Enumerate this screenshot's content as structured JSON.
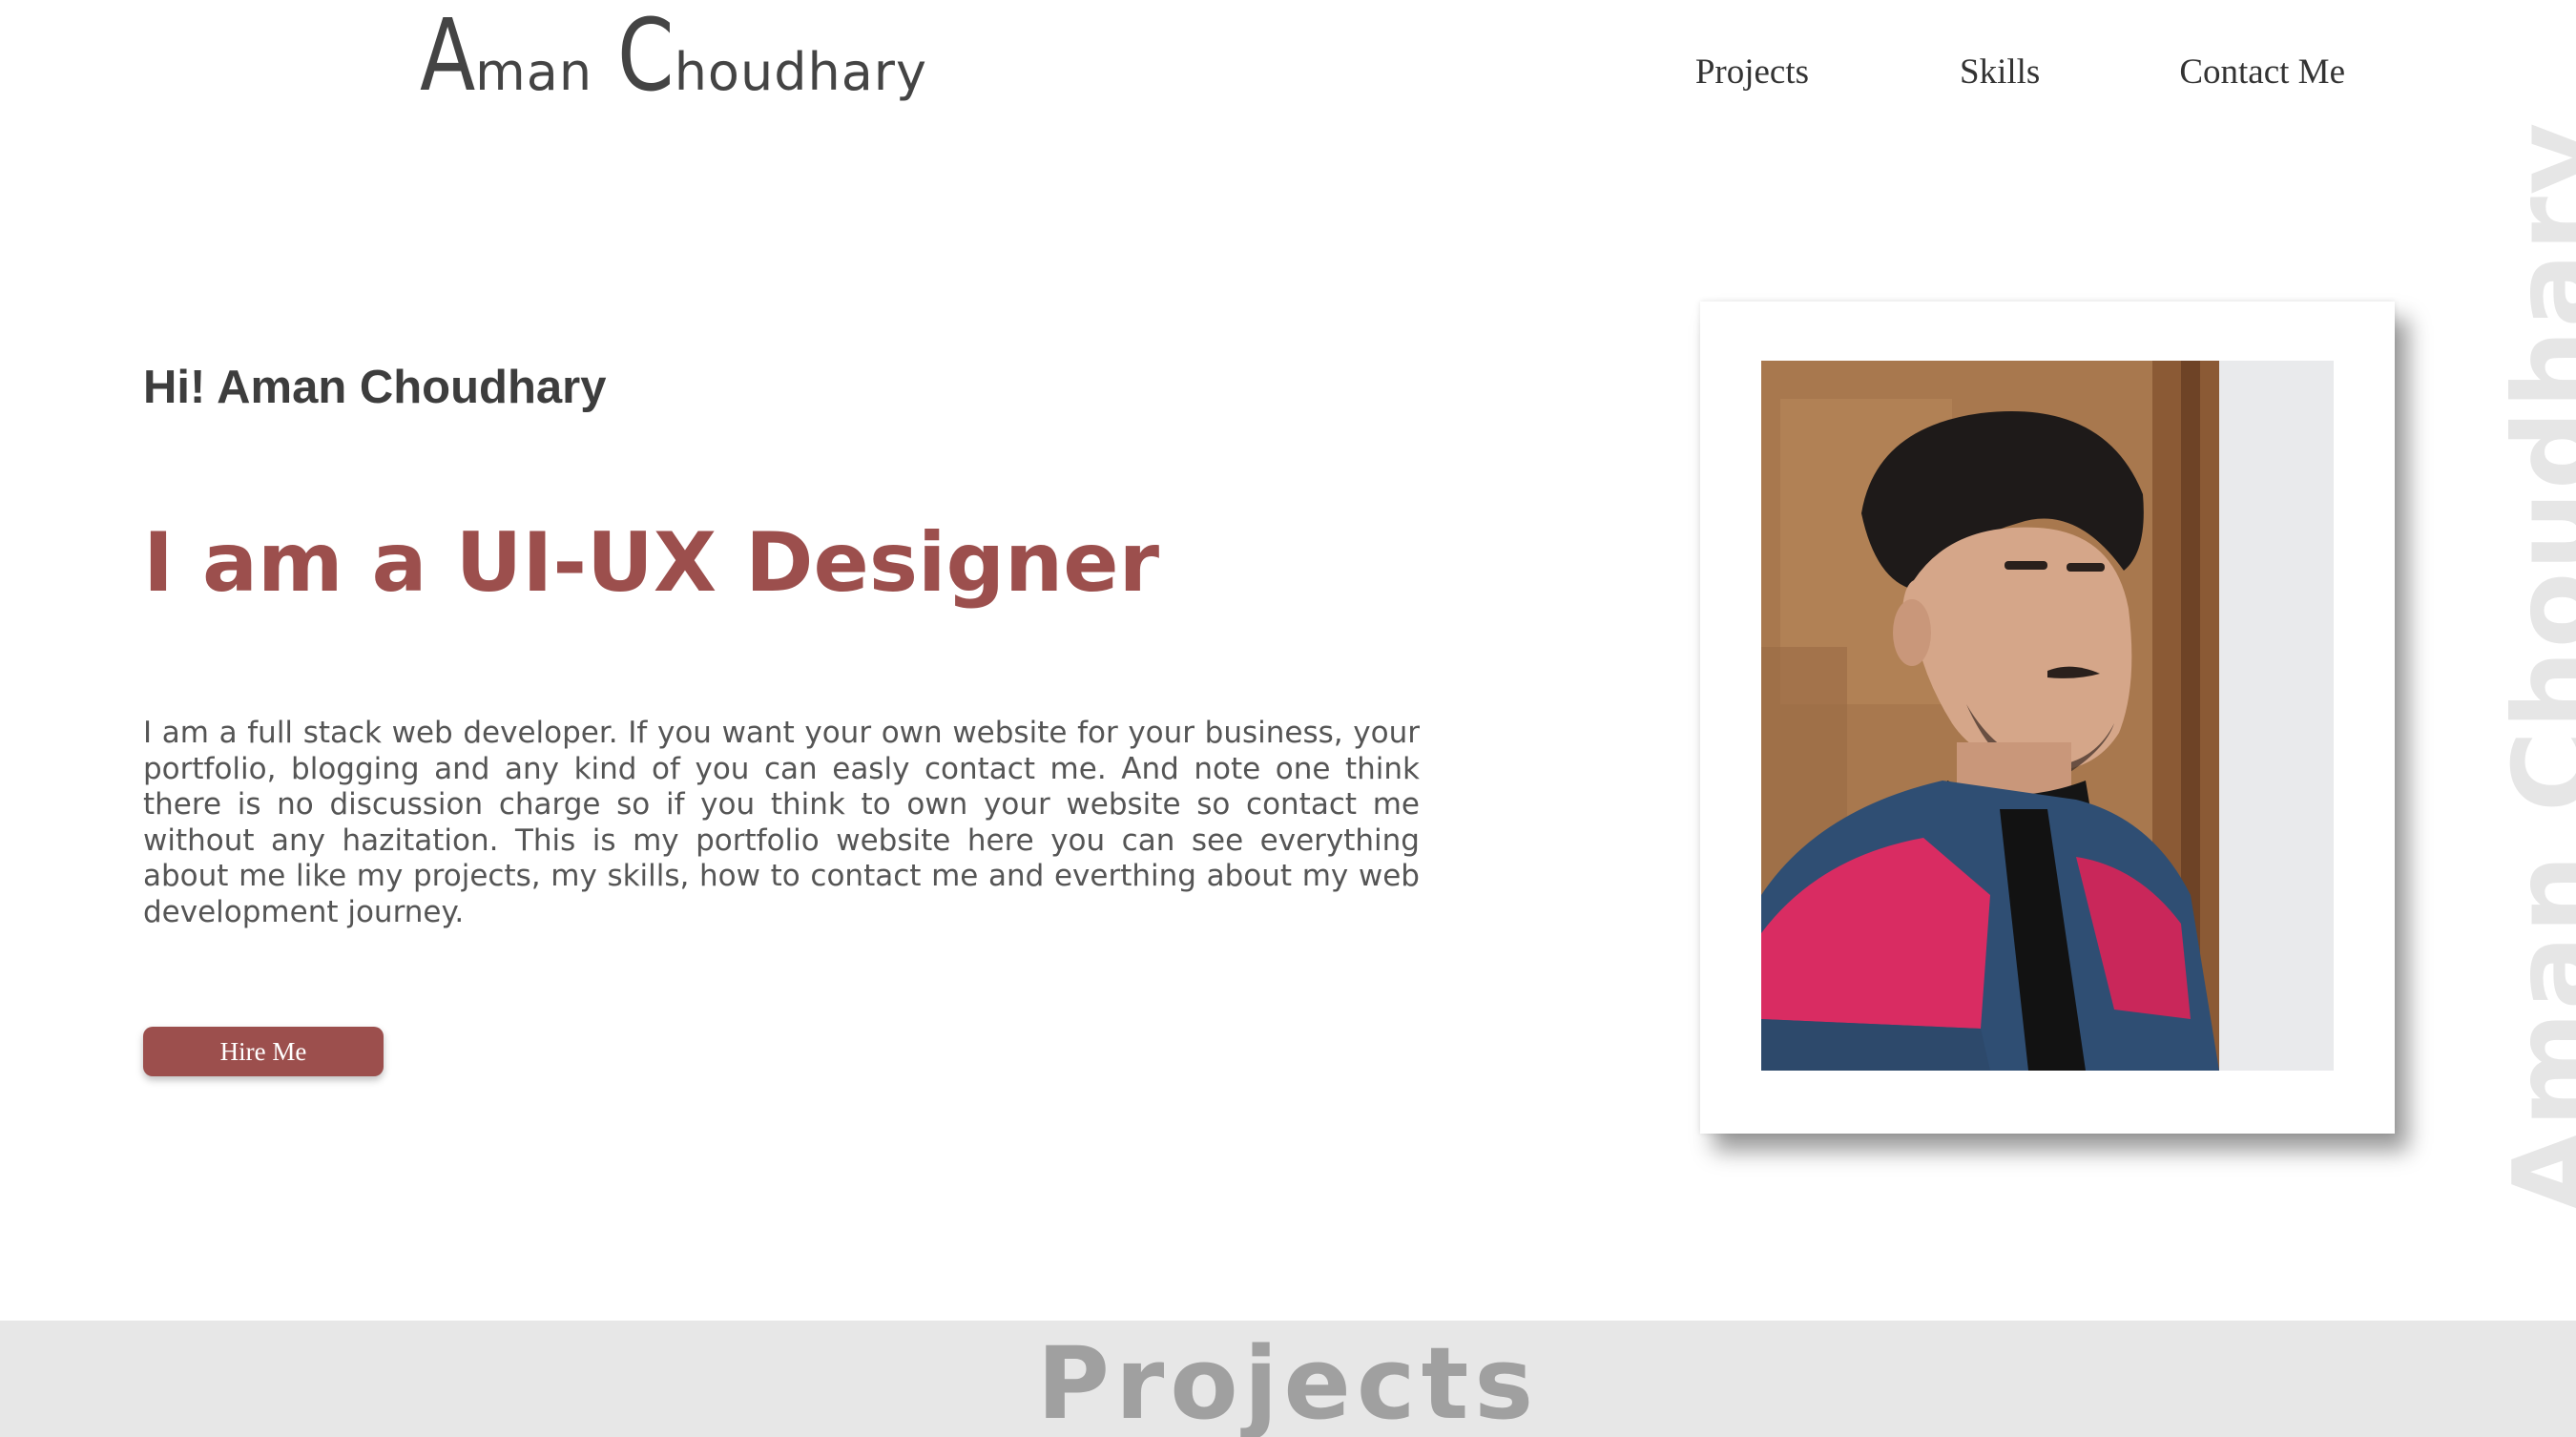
{
  "header": {
    "logo": {
      "first_initial": "A",
      "first_rest": "man",
      "last_initial": "C",
      "last_rest": "houdhary"
    },
    "nav": [
      "Projects",
      "Skills",
      "Contact Me"
    ]
  },
  "hero": {
    "greeting": "Hi! Aman Choudhary",
    "headline": "I am a UI-UX Designer",
    "bio": "I am a full stack web developer. If you want your own website for your business, your portfolio, blogging and any kind of you can easly contact me. And note one think there is no discussion charge so if you think to own your website so contact me without any hazitation. This is my portfolio website here you can see everything about me like my projects, my skills, how to contact me and everthing about my web development journey.",
    "cta_label": "Hire Me"
  },
  "photo": {
    "subject": "profile-photo"
  },
  "watermark": {
    "vertical_name": "Aman Choudhary"
  },
  "sections": {
    "projects_title": "Projects"
  },
  "colors": {
    "accent": "#9c4f4d",
    "text_dark": "#333333",
    "band_bg": "#e7e7e7",
    "watermark": "#e6e6e6"
  }
}
